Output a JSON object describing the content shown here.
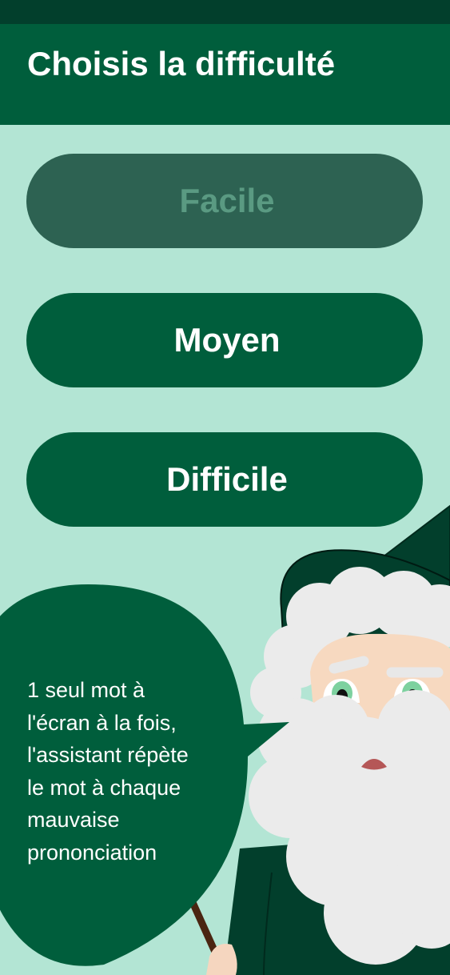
{
  "header": {
    "title": "Choisis la difficulté"
  },
  "difficulty": {
    "options": [
      {
        "label": "Facile",
        "enabled": false
      },
      {
        "label": "Moyen",
        "enabled": true
      },
      {
        "label": "Difficile",
        "enabled": true
      }
    ]
  },
  "assistant": {
    "bubble_text": "1 seul mot à\nl'écran à la fois,\nl'assistant  répète\nle mot à chaque\nmauvaise\nprononciation"
  },
  "colors": {
    "primary": "#005e3c",
    "status_bar": "#023f2c",
    "background": "#b3e5d4",
    "disabled_button": "#2d6252",
    "disabled_text": "#5a9a82"
  }
}
